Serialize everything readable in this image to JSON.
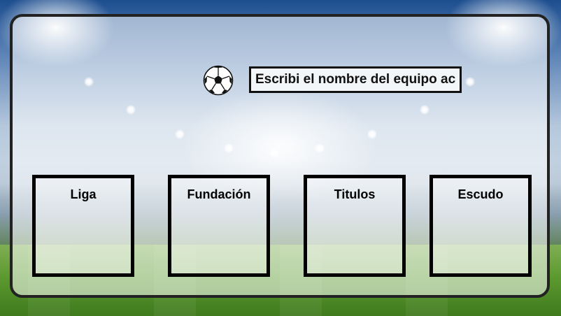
{
  "search": {
    "placeholder": "Escribi el nombre del equipo aca",
    "value": ""
  },
  "ball": {
    "icon": "soccer-ball-icon"
  },
  "boxes": [
    {
      "label": "Liga"
    },
    {
      "label": "Fundación"
    },
    {
      "label": "Titulos"
    },
    {
      "label": "Escudo"
    }
  ],
  "colors": {
    "border": "#000000",
    "card_border": "#222222"
  }
}
